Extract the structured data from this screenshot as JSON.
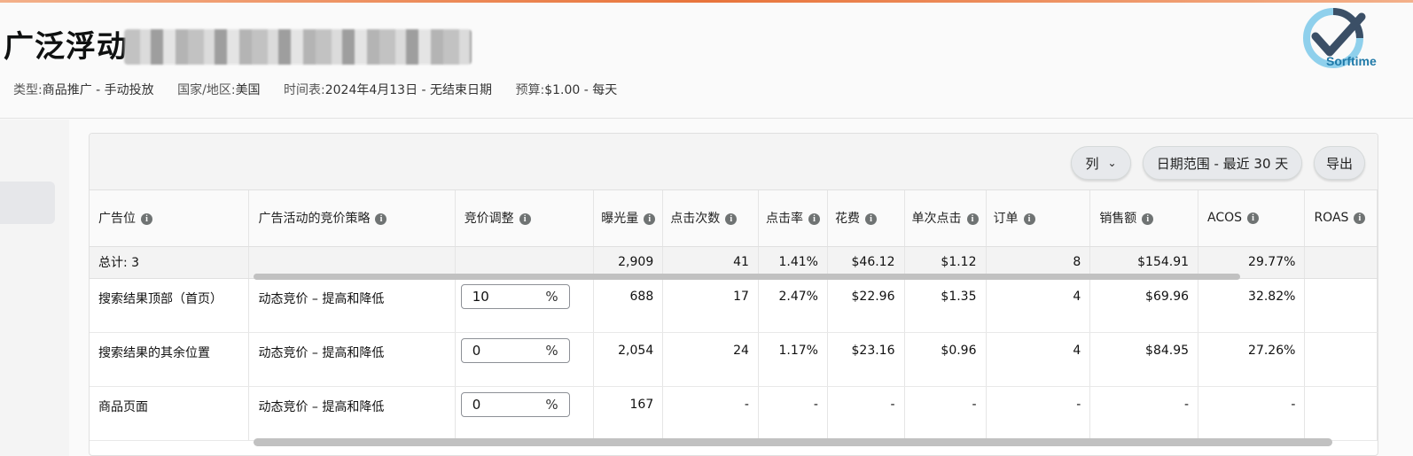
{
  "header": {
    "title": "广泛浮动",
    "meta": [
      {
        "key": "类型:",
        "value": "商品推广 - 手动投放"
      },
      {
        "key": "国家/地区:",
        "value": "美国"
      },
      {
        "key": "时间表:",
        "value": "2024年4月13日 - 无结束日期"
      },
      {
        "key": "预算:",
        "value": "$1.00 - 每天"
      }
    ],
    "logo_text": "Sorftime"
  },
  "toolbar": {
    "columns_label": "列",
    "date_range_label": "日期范围 - 最近 30 天",
    "export_label": "导出"
  },
  "table": {
    "headers": [
      "广告位",
      "广告活动的竞价策略",
      "竞价调整",
      "曝光量",
      "点击次数",
      "点击率",
      "花费",
      "单次点击",
      "订单",
      "销售额",
      "ACOS",
      "ROAS"
    ],
    "total": {
      "label": "总计: 3",
      "impressions": "2,909",
      "clicks": "41",
      "ctr": "1.41%",
      "spend": "$46.12",
      "cpc": "$1.12",
      "orders": "8",
      "sales": "$154.91",
      "acos": "29.77%",
      "roas": ""
    },
    "rows": [
      {
        "placement": "搜索结果顶部（首页）",
        "strategy": "动态竞价 – 提高和降低",
        "bid": "10",
        "impressions": "688",
        "clicks": "17",
        "ctr": "2.47%",
        "spend": "$22.96",
        "cpc": "$1.35",
        "orders": "4",
        "sales": "$69.96",
        "acos": "32.82%",
        "roas": ""
      },
      {
        "placement": "搜索结果的其余位置",
        "strategy": "动态竞价 – 提高和降低",
        "bid": "0",
        "impressions": "2,054",
        "clicks": "24",
        "ctr": "1.17%",
        "spend": "$23.16",
        "cpc": "$0.96",
        "orders": "4",
        "sales": "$84.95",
        "acos": "27.26%",
        "roas": ""
      },
      {
        "placement": "商品页面",
        "strategy": "动态竞价 – 提高和降低",
        "bid": "0",
        "impressions": "167",
        "clicks": "-",
        "ctr": "-",
        "spend": "-",
        "cpc": "-",
        "orders": "-",
        "sales": "-",
        "acos": "-",
        "roas": ""
      }
    ],
    "percent_symbol": "%"
  },
  "colors": {
    "accent_line": "#e8743b",
    "logo_blue": "#1f79a8",
    "logo_dark": "#3b4f66"
  }
}
